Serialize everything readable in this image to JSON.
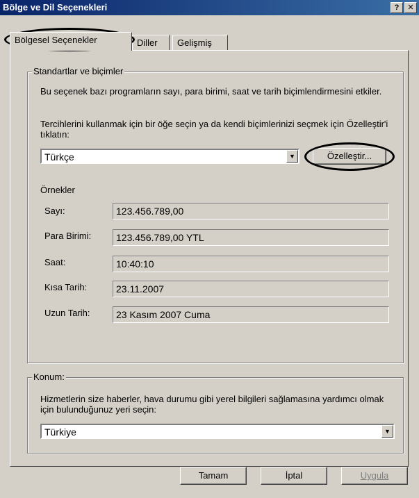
{
  "window": {
    "title": "Bölge ve Dil Seçenekleri",
    "help_btn": "?",
    "close_btn": "✕"
  },
  "tabs": [
    {
      "label": "Bölgesel Seçenekler"
    },
    {
      "label": "Diller"
    },
    {
      "label": "Gelişmiş"
    }
  ],
  "standards": {
    "legend": "Standartlar ve biçimler",
    "desc": "Bu seçenek bazı programların sayı, para birimi, saat ve tarih biçimlendirmesini etkiler.",
    "instruction": "Tercihlerini kullanmak için bir öğe seçin ya da kendi biçimlerinizi seçmek için Özelleştir'i tıklatın:",
    "selected_locale": "Türkçe",
    "customize_btn": "Özelleştir..."
  },
  "examples": {
    "title": "Örnekler",
    "rows": [
      {
        "label": "Sayı:",
        "value": "123.456.789,00"
      },
      {
        "label": "Para Birimi:",
        "value": "123.456.789,00 YTL"
      },
      {
        "label": "Saat:",
        "value": "10:40:10"
      },
      {
        "label": "Kısa Tarih:",
        "value": "23.11.2007"
      },
      {
        "label": "Uzun Tarih:",
        "value": "23 Kasım 2007 Cuma"
      }
    ]
  },
  "location": {
    "legend": "Konum:",
    "desc": "Hizmetlerin size haberler, hava durumu gibi yerel bilgileri sağlamasına yardımcı olmak için bulunduğunuz yeri seçin:",
    "selected_location": "Türkiye"
  },
  "buttons": {
    "ok": "Tamam",
    "cancel": "İptal",
    "apply": "Uygula"
  },
  "colors": {
    "title_bar": "#0a246a",
    "face": "#d4d0c8",
    "disabled_text": "#808080"
  }
}
